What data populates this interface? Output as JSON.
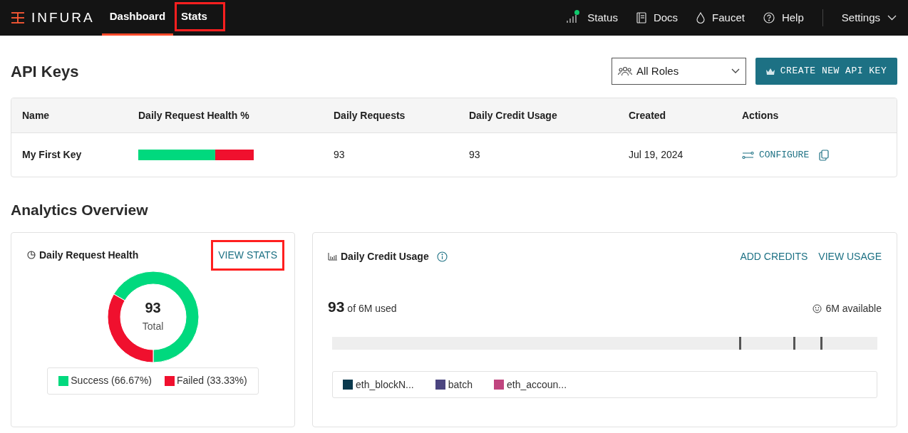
{
  "header": {
    "logo": "INFURA",
    "nav": [
      {
        "label": "Dashboard",
        "selected": true,
        "highlighted": false
      },
      {
        "label": "Stats",
        "selected": false,
        "highlighted": true
      }
    ],
    "links": [
      {
        "label": "Status",
        "kind": "status"
      },
      {
        "label": "Docs",
        "kind": "docs"
      },
      {
        "label": "Faucet",
        "kind": "faucet"
      },
      {
        "label": "Help",
        "kind": "help"
      }
    ],
    "settings": "Settings"
  },
  "api_keys": {
    "title": "API Keys",
    "role_filter": {
      "value": "All Roles"
    },
    "create_button": "CREATE NEW API KEY",
    "table": {
      "columns": [
        "Name",
        "Daily Request Health %",
        "Daily Requests",
        "Daily Credit Usage",
        "Created",
        "Actions"
      ],
      "rows": [
        {
          "name": "My First Key",
          "health": {
            "level": 0.6667
          },
          "daily_requests": "93",
          "daily_credit_usage": "93",
          "created": "Jul 19, 2024",
          "action": "CONFIGURE"
        }
      ]
    }
  },
  "analytics": {
    "title": "Analytics Overview",
    "health_card": {
      "title": "Daily Request Health",
      "link": {
        "label": "VIEW STATS",
        "highlighted": true
      },
      "total": "93",
      "total_label": "Total",
      "chart_data": {
        "type": "donut",
        "categories": [
          "Success",
          "Failed"
        ],
        "values": [
          66.67,
          33.33
        ]
      },
      "legend": [
        {
          "percent": "(66.67%)",
          "color": "#00d97e"
        },
        {
          "percent": "(33.33%)",
          "color": "#f0102e"
        }
      ]
    },
    "credit_card": {
      "title": "Daily Credit Usage",
      "links": [
        "ADD CREDITS",
        "VIEW USAGE"
      ],
      "used": "93",
      "used_suffix": "of 6M used",
      "available": "6M available",
      "legend": [
        {
          "label": "eth_blockN...",
          "color": "#0b3a4e"
        },
        {
          "label": "batch",
          "color": "#4b4580"
        },
        {
          "label": "eth_accoun...",
          "color": "#c0457f"
        }
      ]
    }
  }
}
